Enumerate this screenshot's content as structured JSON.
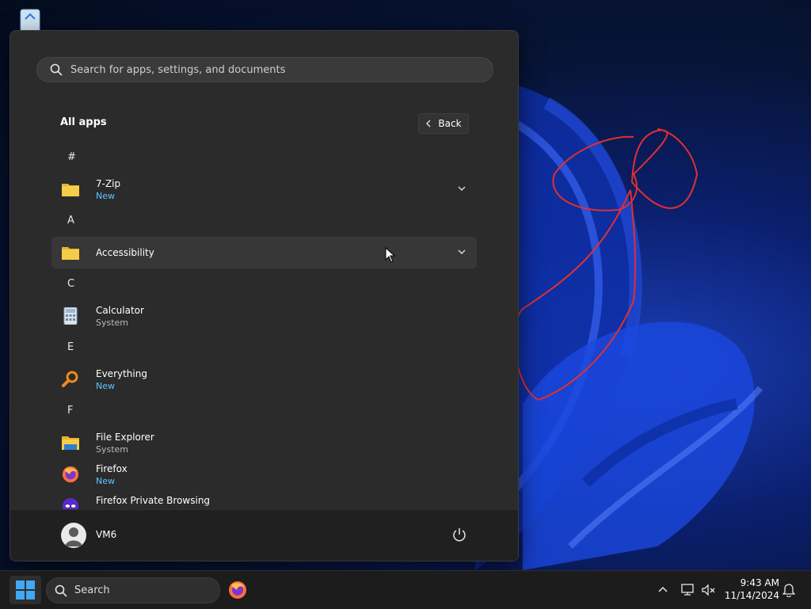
{
  "search": {
    "placeholder": "Search for apps, settings, and documents"
  },
  "all_apps": {
    "title": "All apps",
    "back_label": "Back"
  },
  "sections": [
    {
      "letter": "#",
      "apps": [
        {
          "name": "7-Zip",
          "sub": "New",
          "icon": "folder-icon",
          "expandable": true
        }
      ]
    },
    {
      "letter": "A",
      "apps": [
        {
          "name": "Accessibility",
          "sub": "",
          "icon": "folder-icon",
          "expandable": true
        }
      ]
    },
    {
      "letter": "C",
      "apps": [
        {
          "name": "Calculator",
          "sub": "System",
          "icon": "calculator-icon"
        }
      ]
    },
    {
      "letter": "E",
      "apps": [
        {
          "name": "Everything",
          "sub": "New",
          "icon": "magnifier-icon"
        }
      ]
    },
    {
      "letter": "F",
      "apps": [
        {
          "name": "File Explorer",
          "sub": "System",
          "icon": "file-explorer-icon"
        },
        {
          "name": "Firefox",
          "sub": "New",
          "icon": "firefox-icon"
        },
        {
          "name": "Firefox Private Browsing",
          "sub": "",
          "icon": "firefox-private-icon"
        }
      ]
    }
  ],
  "user": {
    "name": "VM6"
  },
  "taskbar": {
    "search_label": "Search"
  },
  "clock": {
    "time": "9:43 AM",
    "date": "11/14/2024"
  },
  "colors": {
    "accent": "#5cc6ff",
    "menu_bg": "#2b2b2b",
    "taskbar_bg": "#1c1c1c"
  }
}
